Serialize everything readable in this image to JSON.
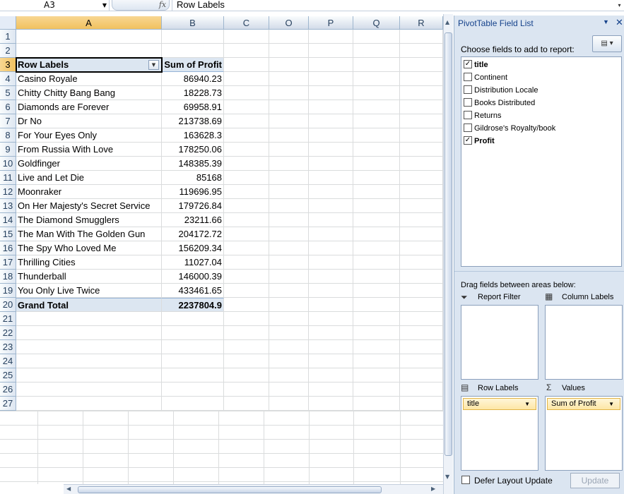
{
  "formula_bar": {
    "name_box": "A3",
    "fx_label": "fx",
    "formula": "Row Labels"
  },
  "sheet": {
    "columns": [
      "A",
      "B",
      "C",
      "O",
      "P",
      "Q",
      "R"
    ],
    "rows": [
      "1",
      "2",
      "3",
      "4",
      "5",
      "6",
      "7",
      "8",
      "9",
      "10",
      "11",
      "12",
      "13",
      "14",
      "15",
      "16",
      "17",
      "18",
      "19",
      "20",
      "21",
      "22",
      "23",
      "24",
      "25",
      "26",
      "27"
    ],
    "pivot": {
      "header_label": "Row Labels",
      "header_value": "Sum of Profit",
      "items": [
        {
          "label": "Casino Royale",
          "value": "86940.23"
        },
        {
          "label": "Chitty Chitty Bang Bang",
          "value": "18228.73"
        },
        {
          "label": "Diamonds are Forever",
          "value": "69958.91"
        },
        {
          "label": "Dr No",
          "value": "213738.69"
        },
        {
          "label": "For Your Eyes Only",
          "value": "163628.3"
        },
        {
          "label": "From Russia With Love",
          "value": "178250.06"
        },
        {
          "label": "Goldfinger",
          "value": "148385.39"
        },
        {
          "label": "Live and Let Die",
          "value": "85168"
        },
        {
          "label": "Moonraker",
          "value": "119696.95"
        },
        {
          "label": "On Her Majesty's Secret Service",
          "value": "179726.84"
        },
        {
          "label": "The Diamond Smugglers",
          "value": "23211.66"
        },
        {
          "label": "The Man With The Golden Gun",
          "value": "204172.72"
        },
        {
          "label": "The Spy Who Loved Me",
          "value": "156209.34"
        },
        {
          "label": "Thrilling Cities",
          "value": "11027.04"
        },
        {
          "label": "Thunderball",
          "value": "146000.39"
        },
        {
          "label": "You Only Live Twice",
          "value": "433461.65"
        }
      ],
      "total_label": "Grand Total",
      "total_value": "2237804.9"
    }
  },
  "pane": {
    "title": "PivotTable Field List",
    "choose_label": "Choose fields to add to report:",
    "fields": [
      {
        "label": "title",
        "checked": true
      },
      {
        "label": "Continent",
        "checked": false
      },
      {
        "label": "Distribution Locale",
        "checked": false
      },
      {
        "label": "Books Distributed",
        "checked": false
      },
      {
        "label": "Returns",
        "checked": false
      },
      {
        "label": "Gildrose's Royalty/book",
        "checked": false
      },
      {
        "label": "Profit",
        "checked": true
      }
    ],
    "drag_label": "Drag fields between areas below:",
    "areas": {
      "report_filter": "Report Filter",
      "column_labels": "Column Labels",
      "row_labels": "Row Labels",
      "values": "Values",
      "row_item": "title",
      "value_item": "Sum of Profit"
    },
    "defer_label": "Defer Layout Update",
    "update_label": "Update"
  }
}
